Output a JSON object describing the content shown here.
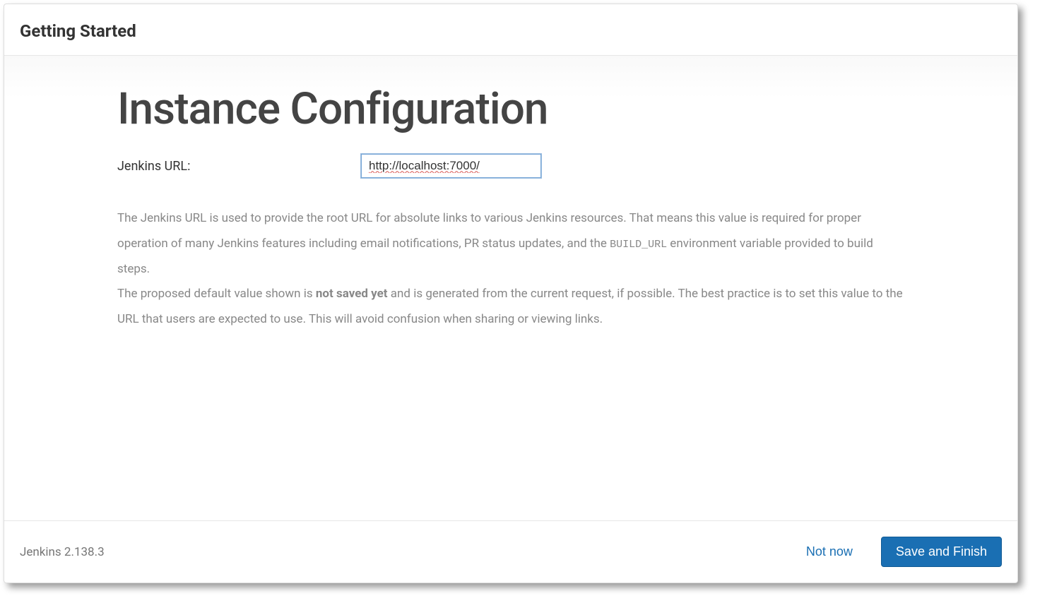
{
  "header": {
    "title": "Getting Started"
  },
  "main": {
    "heading": "Instance Configuration",
    "url_label": "Jenkins URL:",
    "url_value": "http://localhost:7000/",
    "desc_p1_before_code": "The Jenkins URL is used to provide the root URL for absolute links to various Jenkins resources. That means this value is required for proper operation of many Jenkins features including email notifications, PR status updates, and the ",
    "desc_p1_code": "BUILD_URL",
    "desc_p1_after_code": " environment variable provided to build steps.",
    "desc_p2_before_bold": "The proposed default value shown is ",
    "desc_p2_bold": "not saved yet",
    "desc_p2_after_bold": " and is generated from the current request, if possible. The best practice is to set this value to the URL that users are expected to use. This will avoid confusion when sharing or viewing links."
  },
  "footer": {
    "version": "Jenkins 2.138.3",
    "not_now": "Not now",
    "save_finish": "Save and Finish"
  }
}
